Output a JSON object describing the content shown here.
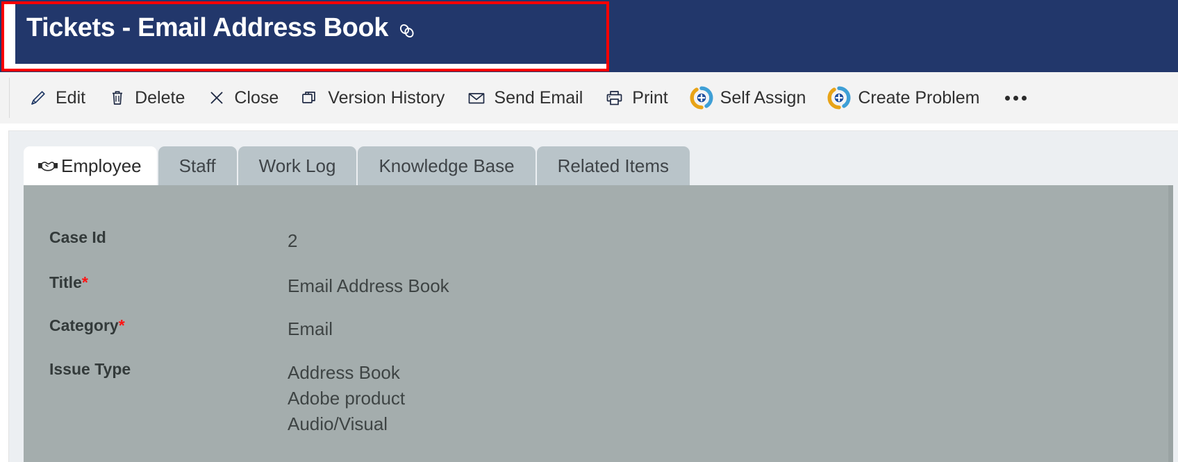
{
  "header": {
    "title": "Tickets - Email Address Book",
    "link_icon": "link-icon",
    "background_color": "#22376b",
    "annotation_color": "#fe0000"
  },
  "toolbar": {
    "items": [
      {
        "label": "Edit",
        "icon": "pencil-icon"
      },
      {
        "label": "Delete",
        "icon": "trash-icon"
      },
      {
        "label": "Close",
        "icon": "close-x-icon"
      },
      {
        "label": "Version History",
        "icon": "version-history-icon"
      },
      {
        "label": "Send Email",
        "icon": "envelope-icon"
      },
      {
        "label": "Print",
        "icon": "printer-icon"
      },
      {
        "label": "Self Assign",
        "icon": "circular-plus-icon"
      },
      {
        "label": "Create Problem",
        "icon": "circular-plus-icon"
      }
    ],
    "overflow_label": "more-options-ellipsis"
  },
  "tabs": [
    {
      "label": "Employee",
      "icon": "handshake-icon",
      "active": true
    },
    {
      "label": "Staff",
      "icon": "",
      "active": false
    },
    {
      "label": "Work Log",
      "icon": "",
      "active": false
    },
    {
      "label": "Knowledge Base",
      "icon": "",
      "active": false
    },
    {
      "label": "Related Items",
      "icon": "",
      "active": false
    }
  ],
  "form": {
    "fields": [
      {
        "label": "Case Id",
        "required": false,
        "values": [
          "2"
        ]
      },
      {
        "label": "Title",
        "required": true,
        "values": [
          "Email Address Book"
        ]
      },
      {
        "label": "Category",
        "required": true,
        "values": [
          "Email"
        ]
      },
      {
        "label": "Issue Type",
        "required": false,
        "values": [
          "Address Book",
          "Adobe product",
          "Audio/Visual"
        ]
      }
    ],
    "required_marker": "*",
    "panel_color": "#a4adad"
  }
}
